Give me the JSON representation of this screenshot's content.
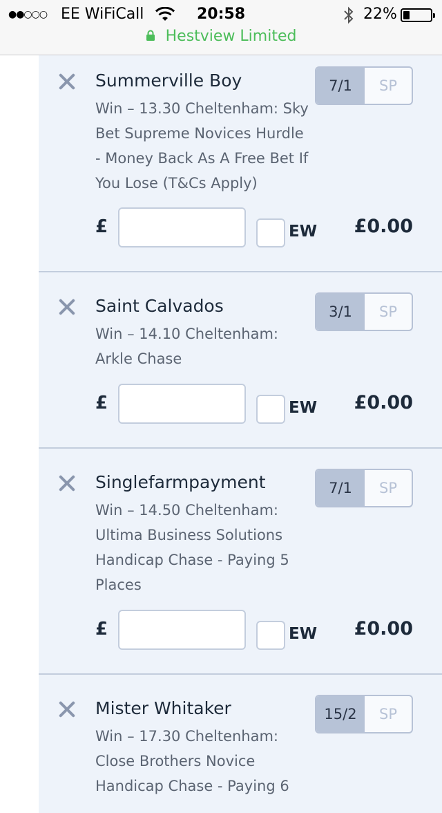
{
  "status_bar": {
    "signal": "●●○○○",
    "carrier": "EE WiFiCall",
    "time": "20:58",
    "battery": "22%",
    "site": "Hestview Limited"
  },
  "icons": {
    "wifi": "wifi-icon",
    "bluetooth": "bluetooth-icon",
    "battery": "battery-icon",
    "lock": "lock-icon",
    "remove": "close-icon"
  },
  "colors": {
    "secure_green": "#4cbd5a",
    "card_bg": "#eef3fa",
    "price_bg": "#b7c3d7"
  },
  "bets": [
    {
      "runner": "Summerville Boy",
      "desc": "Win – 13.30 Cheltenham: Sky Bet Supreme Novices Hurdle - Money Back As A Free Bet If You Lose (T&Cs Apply)",
      "price": "7/1",
      "sp": "SP",
      "currency": "£",
      "ew": "EW",
      "returns": "£0.00"
    },
    {
      "runner": "Saint Calvados",
      "desc": "Win – 14.10 Cheltenham: Arkle Chase",
      "price": "3/1",
      "sp": "SP",
      "currency": "£",
      "ew": "EW",
      "returns": "£0.00"
    },
    {
      "runner": "Singlefarmpayment",
      "desc": "Win – 14.50 Cheltenham: Ultima Business Solutions Handicap Chase - Paying 5 Places",
      "price": "7/1",
      "sp": "SP",
      "currency": "£",
      "ew": "EW",
      "returns": "£0.00"
    },
    {
      "runner": "Mister Whitaker",
      "desc": "Win – 17.30 Cheltenham: Close Brothers Novice Handicap Chase - Paying 6",
      "price": "15/2",
      "sp": "SP",
      "currency": "£",
      "ew": "EW",
      "returns": "£0.00"
    }
  ]
}
